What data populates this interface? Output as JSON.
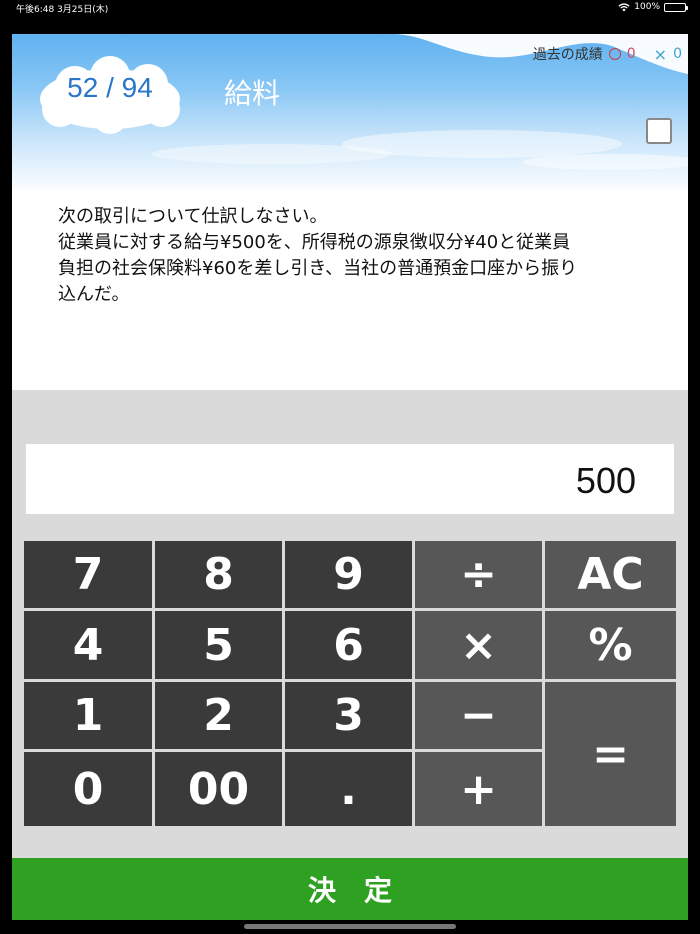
{
  "status_bar": {
    "time": "午後6:48 3月25日(木)",
    "battery": "100%"
  },
  "header": {
    "counter": "52 / 94",
    "title": "給料",
    "record_label": "過去の成績",
    "correct_count": "0",
    "wrong_mark": "×",
    "wrong_count": "0"
  },
  "question": {
    "line1": "次の取引について仕訳しなさい。",
    "line2": "従業員に対する給与¥500を、所得税の源泉徴収分¥40と従業員",
    "line3": "負担の社会保険料¥60を差し引き、当社の普通預金口座から振り",
    "line4": "込んだ。"
  },
  "display": {
    "value": "500"
  },
  "keypad": {
    "keys": [
      "7",
      "8",
      "9",
      "÷",
      "AC",
      "4",
      "5",
      "6",
      "×",
      "%",
      "1",
      "2",
      "3",
      "−",
      "=",
      "0",
      "00",
      ".",
      "+"
    ]
  },
  "submit": {
    "label": "決定"
  },
  "colors": {
    "submit": "#2fa122",
    "counter": "#2a76c8",
    "key_dark": "#3a3a3a",
    "key_op": "#575757"
  }
}
